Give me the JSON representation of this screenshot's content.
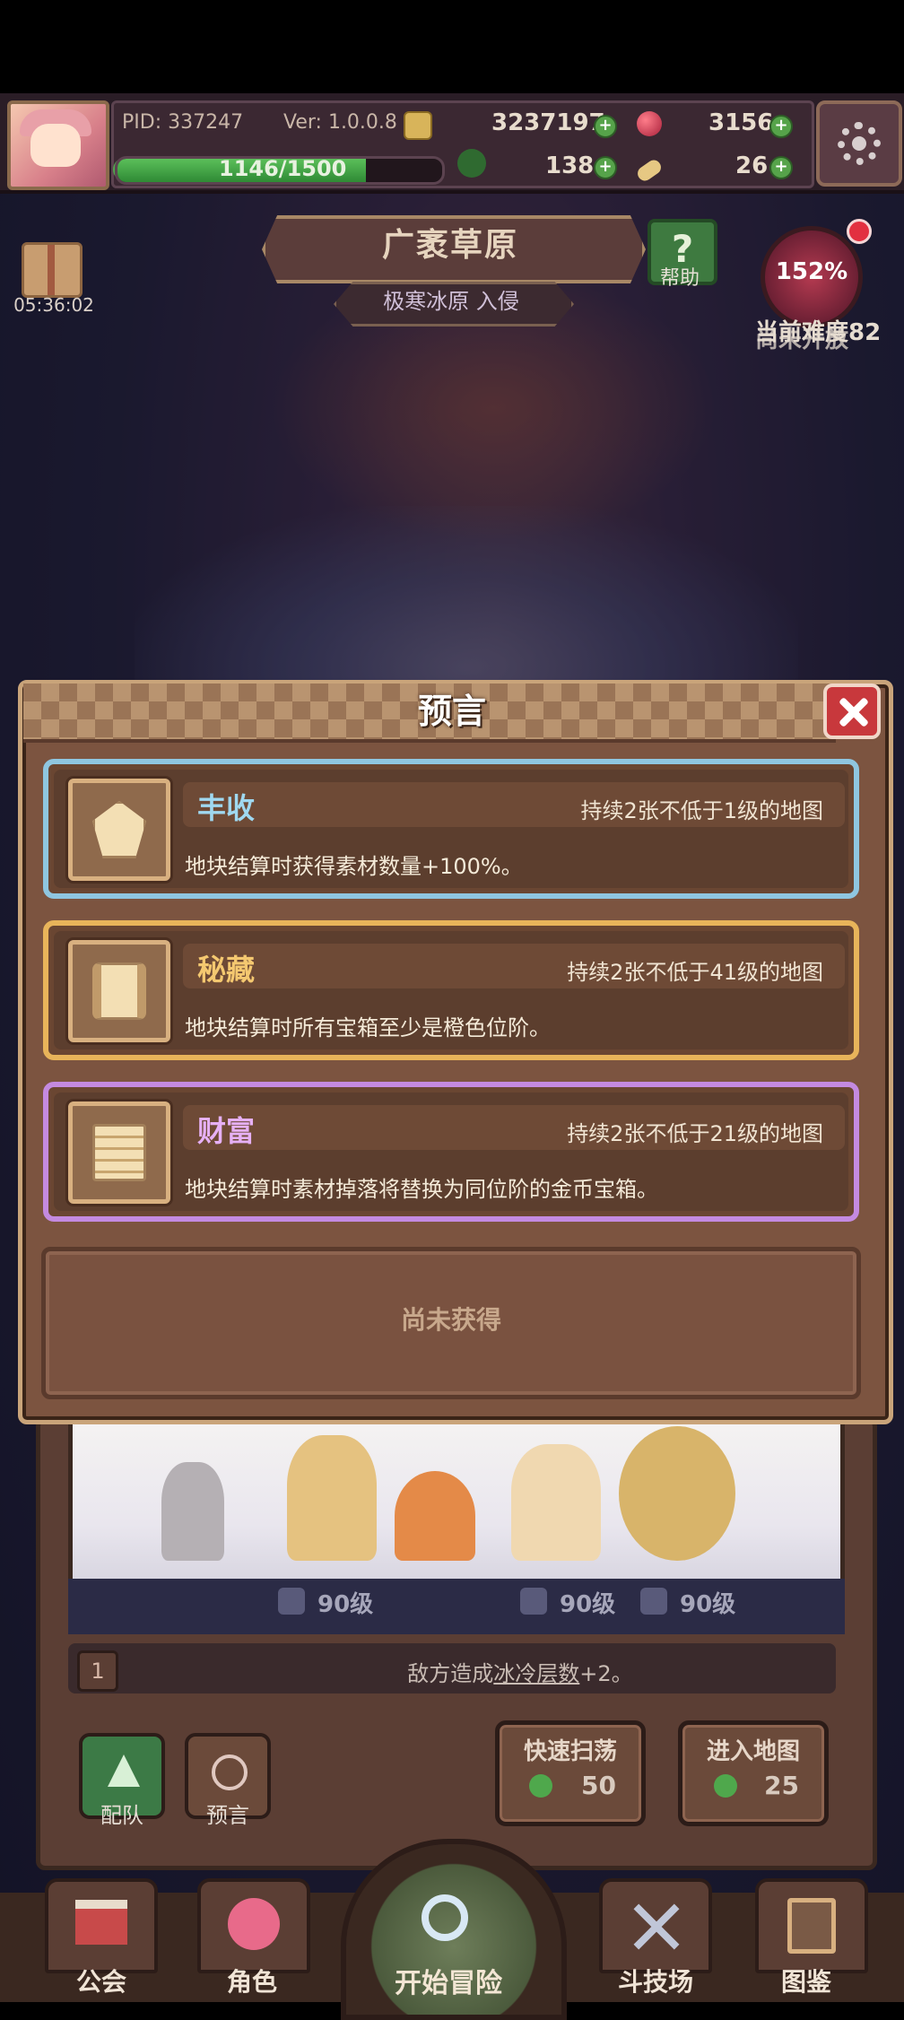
{
  "topbar": {
    "pid": "PID: 337247",
    "version": "Ver: 1.0.0.8",
    "gold": "3237197",
    "gems": "3156",
    "xp": "1146/1500",
    "xp_fraction": 0.764,
    "clover": "138",
    "bone": "26"
  },
  "map": {
    "name": "广袤草原",
    "invasion": "极寒冰原 入侵",
    "help_label": "帮助"
  },
  "gift": {
    "timer": "05:36:02"
  },
  "difficulty": {
    "percent": "152%",
    "label": "当前难度82",
    "label2": "尚未开放"
  },
  "modal": {
    "title": "预言",
    "cards": [
      {
        "name": "丰收",
        "condition": "持续2张不低于1级的地图",
        "desc": "地块结算时获得素材数量+100%。",
        "icon": "harvest-icon",
        "border_color": "#8fc6e0",
        "name_color": "#9fd8f0"
      },
      {
        "name": "秘藏",
        "condition": "持续2张不低于41级的地图",
        "desc": "地块结算时所有宝箱至少是橙色位阶。",
        "icon": "scroll-icon",
        "border_color": "#e8b45a",
        "name_color": "#f4c870"
      },
      {
        "name": "财富",
        "condition": "持续2张不低于21级的地图",
        "desc": "地块结算时素材掉落将替换为同位阶的金币宝箱。",
        "icon": "coin-stack-icon",
        "border_color": "#c48ae0",
        "name_color": "#e6b0f5"
      }
    ],
    "empty_text": "尚未获得"
  },
  "team": {
    "levels": [
      "90级",
      "90级",
      "90级"
    ],
    "skill_index": "1",
    "skill_text_prefix": "敌方造成",
    "skill_text_link": "冰冷层数",
    "skill_text_suffix": "+2。"
  },
  "actions": {
    "formation_label": "配队",
    "prophecy_label": "预言",
    "quick_sweep_label": "快速扫荡",
    "quick_sweep_cost": "50",
    "enter_map_label": "进入地图",
    "enter_map_cost": "25"
  },
  "nav": {
    "guild": "公会",
    "character": "角色",
    "start": "开始冒险",
    "arena": "斗技场",
    "codex": "图鉴"
  }
}
